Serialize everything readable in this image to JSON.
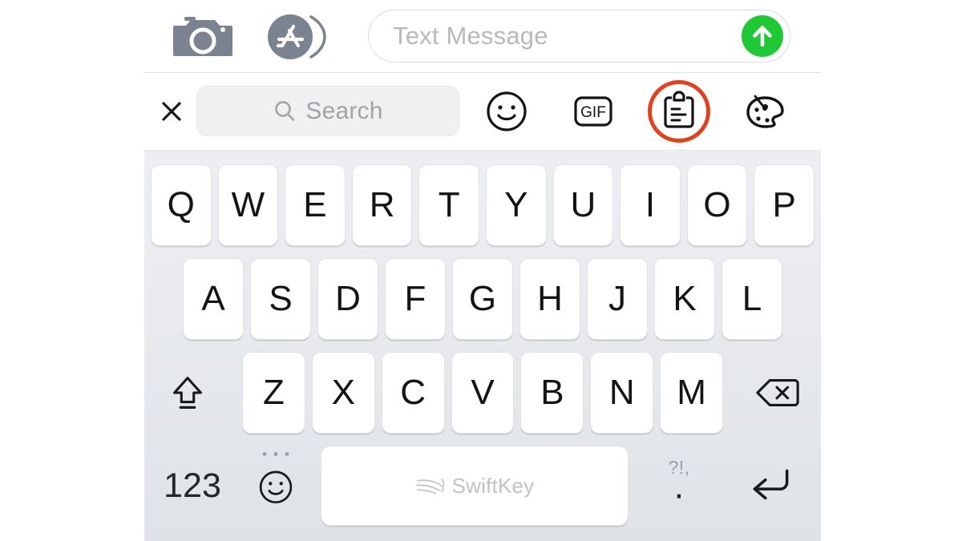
{
  "compose_bar": {
    "camera_icon": "camera-icon",
    "appstore_icon": "app-store-icon",
    "message_placeholder": "Text Message",
    "message_value": "",
    "send_icon": "send-arrow-up-icon",
    "send_color": "#1EC935"
  },
  "sticker_bar": {
    "close_icon": "close-x-icon",
    "search_placeholder": "Search",
    "search_value": "",
    "search_icon": "search-magnifier-icon",
    "tools": [
      {
        "name": "emoji-smiley-icon",
        "label": ""
      },
      {
        "name": "gif-icon",
        "label": "GIF"
      },
      {
        "name": "clipboard-icon",
        "label": "",
        "highlighted": true
      },
      {
        "name": "palette-icon",
        "label": ""
      }
    ],
    "highlight_color": "#E0411F"
  },
  "keyboard": {
    "row1": [
      "Q",
      "W",
      "E",
      "R",
      "T",
      "Y",
      "U",
      "I",
      "O",
      "P"
    ],
    "row2": [
      "A",
      "S",
      "D",
      "F",
      "G",
      "H",
      "J",
      "K",
      "L"
    ],
    "row3": [
      "Z",
      "X",
      "C",
      "V",
      "B",
      "N",
      "M"
    ],
    "shift_icon": "shift-arrow-up-icon",
    "backspace_icon": "backspace-delete-icon",
    "bottom": {
      "numbers_label": "123",
      "emoji_icon": "emoji-smiley-key-icon",
      "space_brand": "SwiftKey",
      "space_logo_icon": "swiftkey-logo-icon",
      "punctuation_secondary": "?!,",
      "punctuation_primary": "·",
      "enter_icon": "return-enter-icon"
    }
  }
}
